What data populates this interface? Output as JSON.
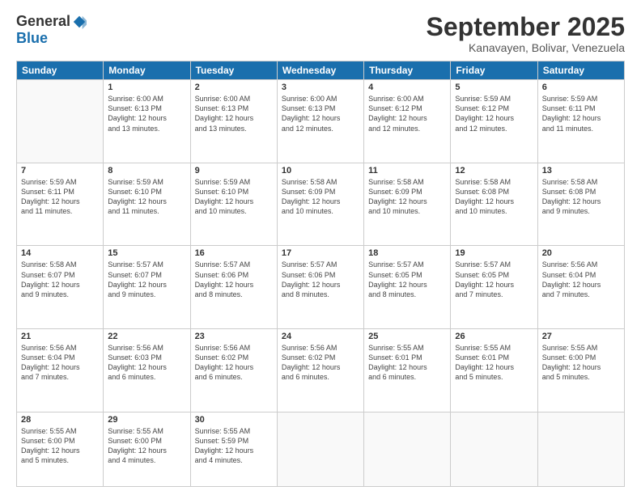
{
  "logo": {
    "general": "General",
    "blue": "Blue"
  },
  "title": "September 2025",
  "subtitle": "Kanavayen, Bolivar, Venezuela",
  "header_days": [
    "Sunday",
    "Monday",
    "Tuesday",
    "Wednesday",
    "Thursday",
    "Friday",
    "Saturday"
  ],
  "weeks": [
    [
      {
        "day": "",
        "info": ""
      },
      {
        "day": "1",
        "info": "Sunrise: 6:00 AM\nSunset: 6:13 PM\nDaylight: 12 hours\nand 13 minutes."
      },
      {
        "day": "2",
        "info": "Sunrise: 6:00 AM\nSunset: 6:13 PM\nDaylight: 12 hours\nand 13 minutes."
      },
      {
        "day": "3",
        "info": "Sunrise: 6:00 AM\nSunset: 6:13 PM\nDaylight: 12 hours\nand 12 minutes."
      },
      {
        "day": "4",
        "info": "Sunrise: 6:00 AM\nSunset: 6:12 PM\nDaylight: 12 hours\nand 12 minutes."
      },
      {
        "day": "5",
        "info": "Sunrise: 5:59 AM\nSunset: 6:12 PM\nDaylight: 12 hours\nand 12 minutes."
      },
      {
        "day": "6",
        "info": "Sunrise: 5:59 AM\nSunset: 6:11 PM\nDaylight: 12 hours\nand 11 minutes."
      }
    ],
    [
      {
        "day": "7",
        "info": "Sunrise: 5:59 AM\nSunset: 6:11 PM\nDaylight: 12 hours\nand 11 minutes."
      },
      {
        "day": "8",
        "info": "Sunrise: 5:59 AM\nSunset: 6:10 PM\nDaylight: 12 hours\nand 11 minutes."
      },
      {
        "day": "9",
        "info": "Sunrise: 5:59 AM\nSunset: 6:10 PM\nDaylight: 12 hours\nand 10 minutes."
      },
      {
        "day": "10",
        "info": "Sunrise: 5:58 AM\nSunset: 6:09 PM\nDaylight: 12 hours\nand 10 minutes."
      },
      {
        "day": "11",
        "info": "Sunrise: 5:58 AM\nSunset: 6:09 PM\nDaylight: 12 hours\nand 10 minutes."
      },
      {
        "day": "12",
        "info": "Sunrise: 5:58 AM\nSunset: 6:08 PM\nDaylight: 12 hours\nand 10 minutes."
      },
      {
        "day": "13",
        "info": "Sunrise: 5:58 AM\nSunset: 6:08 PM\nDaylight: 12 hours\nand 9 minutes."
      }
    ],
    [
      {
        "day": "14",
        "info": "Sunrise: 5:58 AM\nSunset: 6:07 PM\nDaylight: 12 hours\nand 9 minutes."
      },
      {
        "day": "15",
        "info": "Sunrise: 5:57 AM\nSunset: 6:07 PM\nDaylight: 12 hours\nand 9 minutes."
      },
      {
        "day": "16",
        "info": "Sunrise: 5:57 AM\nSunset: 6:06 PM\nDaylight: 12 hours\nand 8 minutes."
      },
      {
        "day": "17",
        "info": "Sunrise: 5:57 AM\nSunset: 6:06 PM\nDaylight: 12 hours\nand 8 minutes."
      },
      {
        "day": "18",
        "info": "Sunrise: 5:57 AM\nSunset: 6:05 PM\nDaylight: 12 hours\nand 8 minutes."
      },
      {
        "day": "19",
        "info": "Sunrise: 5:57 AM\nSunset: 6:05 PM\nDaylight: 12 hours\nand 7 minutes."
      },
      {
        "day": "20",
        "info": "Sunrise: 5:56 AM\nSunset: 6:04 PM\nDaylight: 12 hours\nand 7 minutes."
      }
    ],
    [
      {
        "day": "21",
        "info": "Sunrise: 5:56 AM\nSunset: 6:04 PM\nDaylight: 12 hours\nand 7 minutes."
      },
      {
        "day": "22",
        "info": "Sunrise: 5:56 AM\nSunset: 6:03 PM\nDaylight: 12 hours\nand 6 minutes."
      },
      {
        "day": "23",
        "info": "Sunrise: 5:56 AM\nSunset: 6:02 PM\nDaylight: 12 hours\nand 6 minutes."
      },
      {
        "day": "24",
        "info": "Sunrise: 5:56 AM\nSunset: 6:02 PM\nDaylight: 12 hours\nand 6 minutes."
      },
      {
        "day": "25",
        "info": "Sunrise: 5:55 AM\nSunset: 6:01 PM\nDaylight: 12 hours\nand 6 minutes."
      },
      {
        "day": "26",
        "info": "Sunrise: 5:55 AM\nSunset: 6:01 PM\nDaylight: 12 hours\nand 5 minutes."
      },
      {
        "day": "27",
        "info": "Sunrise: 5:55 AM\nSunset: 6:00 PM\nDaylight: 12 hours\nand 5 minutes."
      }
    ],
    [
      {
        "day": "28",
        "info": "Sunrise: 5:55 AM\nSunset: 6:00 PM\nDaylight: 12 hours\nand 5 minutes."
      },
      {
        "day": "29",
        "info": "Sunrise: 5:55 AM\nSunset: 6:00 PM\nDaylight: 12 hours\nand 4 minutes."
      },
      {
        "day": "30",
        "info": "Sunrise: 5:55 AM\nSunset: 5:59 PM\nDaylight: 12 hours\nand 4 minutes."
      },
      {
        "day": "",
        "info": ""
      },
      {
        "day": "",
        "info": ""
      },
      {
        "day": "",
        "info": ""
      },
      {
        "day": "",
        "info": ""
      }
    ]
  ]
}
